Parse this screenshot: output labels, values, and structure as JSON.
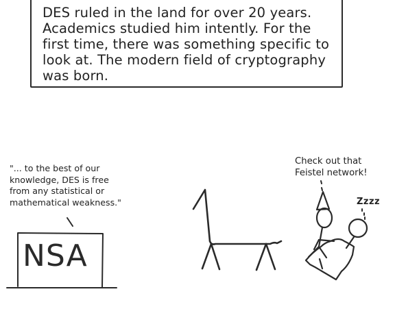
{
  "caption": {
    "lines": [
      "DES ruled in the land for over 20 years.",
      "Academics studied him intently. For the",
      "first time, there was something specific to",
      "look at. The modern field of cryptography",
      "was born."
    ]
  },
  "nsa_quote": {
    "lines": [
      "\"... to the best of our",
      "knowledge, DES is free",
      "from any statistical or",
      "mathematical weakness.\""
    ]
  },
  "nsa_sign": {
    "label": "NSA"
  },
  "academic_speech": {
    "lines": [
      "Check out that",
      "Feistel network!"
    ]
  },
  "sleeper_speech": {
    "label": "Zzzz"
  }
}
